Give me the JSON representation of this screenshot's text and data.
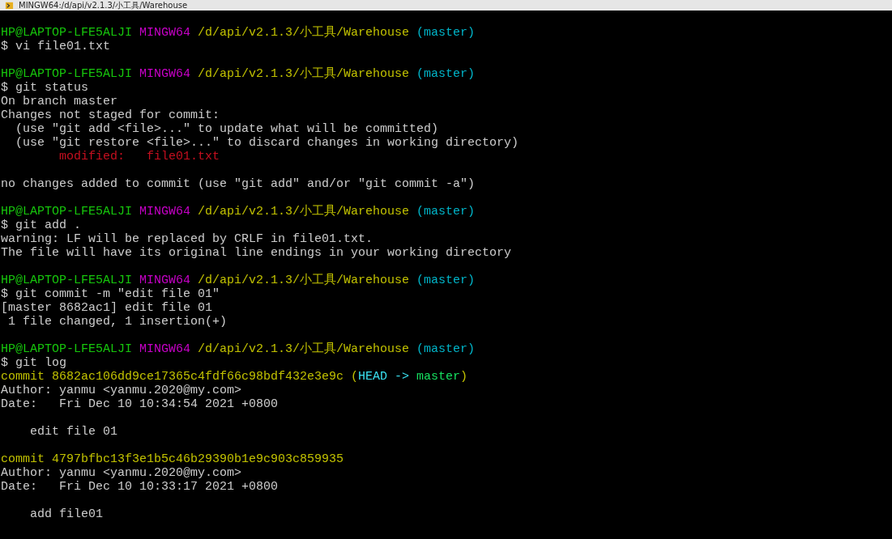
{
  "window": {
    "title": "MINGW64:/d/api/v2.1.3/小工具/Warehouse"
  },
  "lines": [
    {
      "kind": "blank"
    },
    {
      "kind": "prompt",
      "segments": [
        {
          "kind": "user",
          "text": "HP@LAPTOP-LFE5ALJI"
        },
        {
          "kind": "system",
          "text": "MINGW64"
        },
        {
          "kind": "path",
          "text": "/d/api/v2.1.3/小工具/Warehouse"
        },
        {
          "kind": "branch",
          "text": "(master)"
        }
      ]
    },
    {
      "kind": "command",
      "segments": [
        {
          "kind": "plain",
          "text": "$ vi file01.txt"
        }
      ]
    },
    {
      "kind": "blank"
    },
    {
      "kind": "prompt",
      "segments": [
        {
          "kind": "user",
          "text": "HP@LAPTOP-LFE5ALJI"
        },
        {
          "kind": "system",
          "text": "MINGW64"
        },
        {
          "kind": "path",
          "text": "/d/api/v2.1.3/小工具/Warehouse"
        },
        {
          "kind": "branch",
          "text": "(master)"
        }
      ]
    },
    {
      "kind": "command",
      "segments": [
        {
          "kind": "plain",
          "text": "$ git status"
        }
      ]
    },
    {
      "kind": "output",
      "segments": [
        {
          "kind": "plain",
          "text": "On branch master"
        }
      ]
    },
    {
      "kind": "output",
      "segments": [
        {
          "kind": "plain",
          "text": "Changes not staged for commit:"
        }
      ]
    },
    {
      "kind": "output",
      "segments": [
        {
          "kind": "plain",
          "text": "  (use \"git add <file>...\" to update what will be committed)"
        }
      ]
    },
    {
      "kind": "output",
      "segments": [
        {
          "kind": "plain",
          "text": "  (use \"git restore <file>...\" to discard changes in working directory)"
        }
      ]
    },
    {
      "kind": "output",
      "segments": [
        {
          "kind": "modified",
          "text": "        modified:   file01.txt"
        }
      ]
    },
    {
      "kind": "blank"
    },
    {
      "kind": "output",
      "segments": [
        {
          "kind": "plain",
          "text": "no changes added to commit (use \"git add\" and/or \"git commit -a\")"
        }
      ]
    },
    {
      "kind": "blank"
    },
    {
      "kind": "prompt",
      "segments": [
        {
          "kind": "user",
          "text": "HP@LAPTOP-LFE5ALJI"
        },
        {
          "kind": "system",
          "text": "MINGW64"
        },
        {
          "kind": "path",
          "text": "/d/api/v2.1.3/小工具/Warehouse"
        },
        {
          "kind": "branch",
          "text": "(master)"
        }
      ]
    },
    {
      "kind": "command",
      "segments": [
        {
          "kind": "plain",
          "text": "$ git add ."
        }
      ]
    },
    {
      "kind": "output",
      "segments": [
        {
          "kind": "plain",
          "text": "warning: LF will be replaced by CRLF in file01.txt."
        }
      ]
    },
    {
      "kind": "output",
      "segments": [
        {
          "kind": "plain",
          "text": "The file will have its original line endings in your working directory"
        }
      ]
    },
    {
      "kind": "blank"
    },
    {
      "kind": "prompt",
      "segments": [
        {
          "kind": "user",
          "text": "HP@LAPTOP-LFE5ALJI"
        },
        {
          "kind": "system",
          "text": "MINGW64"
        },
        {
          "kind": "path",
          "text": "/d/api/v2.1.3/小工具/Warehouse"
        },
        {
          "kind": "branch",
          "text": "(master)"
        }
      ]
    },
    {
      "kind": "command",
      "segments": [
        {
          "kind": "plain",
          "text": "$ git commit -m \"edit file 01\""
        }
      ]
    },
    {
      "kind": "output",
      "segments": [
        {
          "kind": "plain",
          "text": "[master 8682ac1] edit file 01"
        }
      ]
    },
    {
      "kind": "output",
      "segments": [
        {
          "kind": "plain",
          "text": " 1 file changed, 1 insertion(+)"
        }
      ]
    },
    {
      "kind": "blank"
    },
    {
      "kind": "prompt",
      "segments": [
        {
          "kind": "user",
          "text": "HP@LAPTOP-LFE5ALJI"
        },
        {
          "kind": "system",
          "text": "MINGW64"
        },
        {
          "kind": "path",
          "text": "/d/api/v2.1.3/小工具/Warehouse"
        },
        {
          "kind": "branch",
          "text": "(master)"
        }
      ]
    },
    {
      "kind": "command",
      "segments": [
        {
          "kind": "plain",
          "text": "$ git log"
        }
      ]
    },
    {
      "kind": "output",
      "segments": [
        {
          "kind": "hash",
          "text": "commit 8682ac106dd9ce17365c4fdf66c98bdf432e3e9c ("
        },
        {
          "kind": "head",
          "text": "HEAD -> "
        },
        {
          "kind": "ref",
          "text": "master"
        },
        {
          "kind": "hash",
          "text": ")"
        }
      ]
    },
    {
      "kind": "output",
      "segments": [
        {
          "kind": "plain",
          "text": "Author: yanmu <yanmu.2020@my.com>"
        }
      ]
    },
    {
      "kind": "output",
      "segments": [
        {
          "kind": "plain",
          "text": "Date:   Fri Dec 10 10:34:54 2021 +0800"
        }
      ]
    },
    {
      "kind": "blank"
    },
    {
      "kind": "output",
      "segments": [
        {
          "kind": "plain",
          "text": "    edit file 01"
        }
      ]
    },
    {
      "kind": "blank"
    },
    {
      "kind": "output",
      "segments": [
        {
          "kind": "hash",
          "text": "commit 4797bfbc13f3e1b5c46b29390b1e9c903c859935"
        }
      ]
    },
    {
      "kind": "output",
      "segments": [
        {
          "kind": "plain",
          "text": "Author: yanmu <yanmu.2020@my.com>"
        }
      ]
    },
    {
      "kind": "output",
      "segments": [
        {
          "kind": "plain",
          "text": "Date:   Fri Dec 10 10:33:17 2021 +0800"
        }
      ]
    },
    {
      "kind": "blank"
    },
    {
      "kind": "output",
      "segments": [
        {
          "kind": "plain",
          "text": "    add file01"
        }
      ]
    }
  ]
}
